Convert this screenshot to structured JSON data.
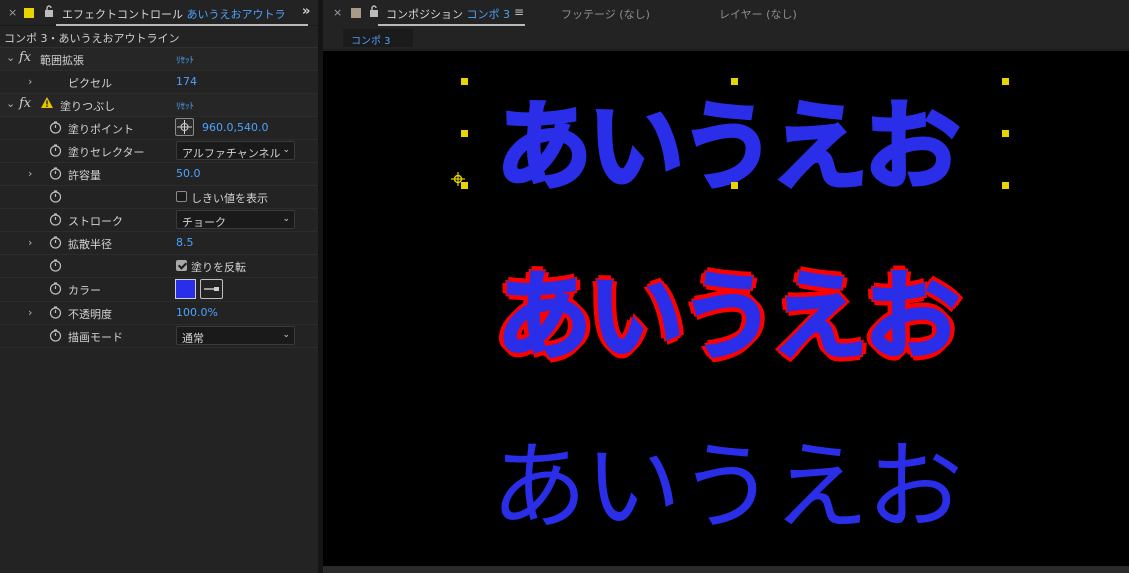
{
  "left_panel": {
    "header": {
      "title": "エフェクトコントロール",
      "title_accent": "あいうえおアウトラ",
      "more": "»"
    },
    "breadcrumb": "コンポ 3・あいうえおアウトライン",
    "effects": [
      {
        "name": "範囲拡張",
        "reset": "ﾘｾｯﾄ",
        "params": [
          {
            "label": "ピクセル",
            "value": "174"
          }
        ]
      },
      {
        "name": "塗りつぶし",
        "reset": "ﾘｾｯﾄ",
        "params": [
          {
            "label": "塗りポイント",
            "value": "960.0,540.0"
          },
          {
            "label": "塗りセレクター",
            "value": "アルファチャンネル"
          },
          {
            "label": "許容量",
            "value": "50.0"
          },
          {
            "label": "",
            "value": "しきい値を表示",
            "checked": false
          },
          {
            "label": "ストローク",
            "value": "チョーク"
          },
          {
            "label": "拡散半径",
            "value": "8.5"
          },
          {
            "label": "",
            "value": "塗りを反転",
            "checked": true
          },
          {
            "label": "カラー",
            "value": "#2b2ee8"
          },
          {
            "label": "不透明度",
            "value": "100.0%"
          },
          {
            "label": "描画モード",
            "value": "通常"
          }
        ]
      }
    ]
  },
  "right_panel": {
    "tabs": [
      {
        "label": "コンポジション",
        "accent": "コンポ 3",
        "active": true
      },
      {
        "label": "フッテージ (なし)",
        "active": false
      },
      {
        "label": "レイヤー (なし)",
        "active": false
      }
    ],
    "menu_icon": "≡",
    "crumb": "コンポ 3",
    "canvas": {
      "lines": [
        "あいうえお",
        "あいうえお",
        "あいうえお"
      ],
      "fill_color": "#2b2ee8",
      "outline_color": "#ff0000",
      "handle_color": "#e8d400"
    }
  },
  "icons": {
    "close": "×",
    "chevron_right": "›",
    "chevron_down": "⌄",
    "dropdown_arrow": "⌄"
  }
}
